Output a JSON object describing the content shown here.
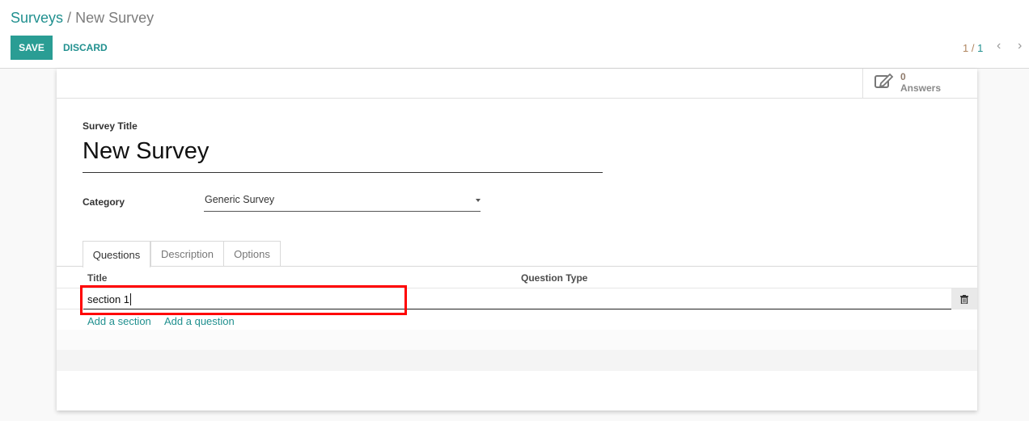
{
  "breadcrumb": {
    "parent": "Surveys",
    "separator": "/",
    "current": "New Survey"
  },
  "toolbar": {
    "save": "SAVE",
    "discard": "DISCARD"
  },
  "pager": {
    "value": "1 / 1",
    "current": "1",
    "total": "1"
  },
  "stat": {
    "count": "0",
    "label": "Answers"
  },
  "form": {
    "title_label": "Survey Title",
    "title": "New Survey",
    "category_label": "Category",
    "category": "Generic Survey"
  },
  "tabs": [
    {
      "label": "Questions",
      "active": true
    },
    {
      "label": "Description"
    },
    {
      "label": "Options"
    }
  ],
  "table": {
    "headers": [
      "Title",
      "Question Type"
    ],
    "rows": [
      {
        "title": "section 1",
        "type": ""
      }
    ]
  },
  "actions": {
    "add_section": "Add a section",
    "add_question": "Add a question"
  },
  "colors": {
    "accent": "#2a9d94",
    "link": "#21908f",
    "highlight": "#ff0000"
  }
}
